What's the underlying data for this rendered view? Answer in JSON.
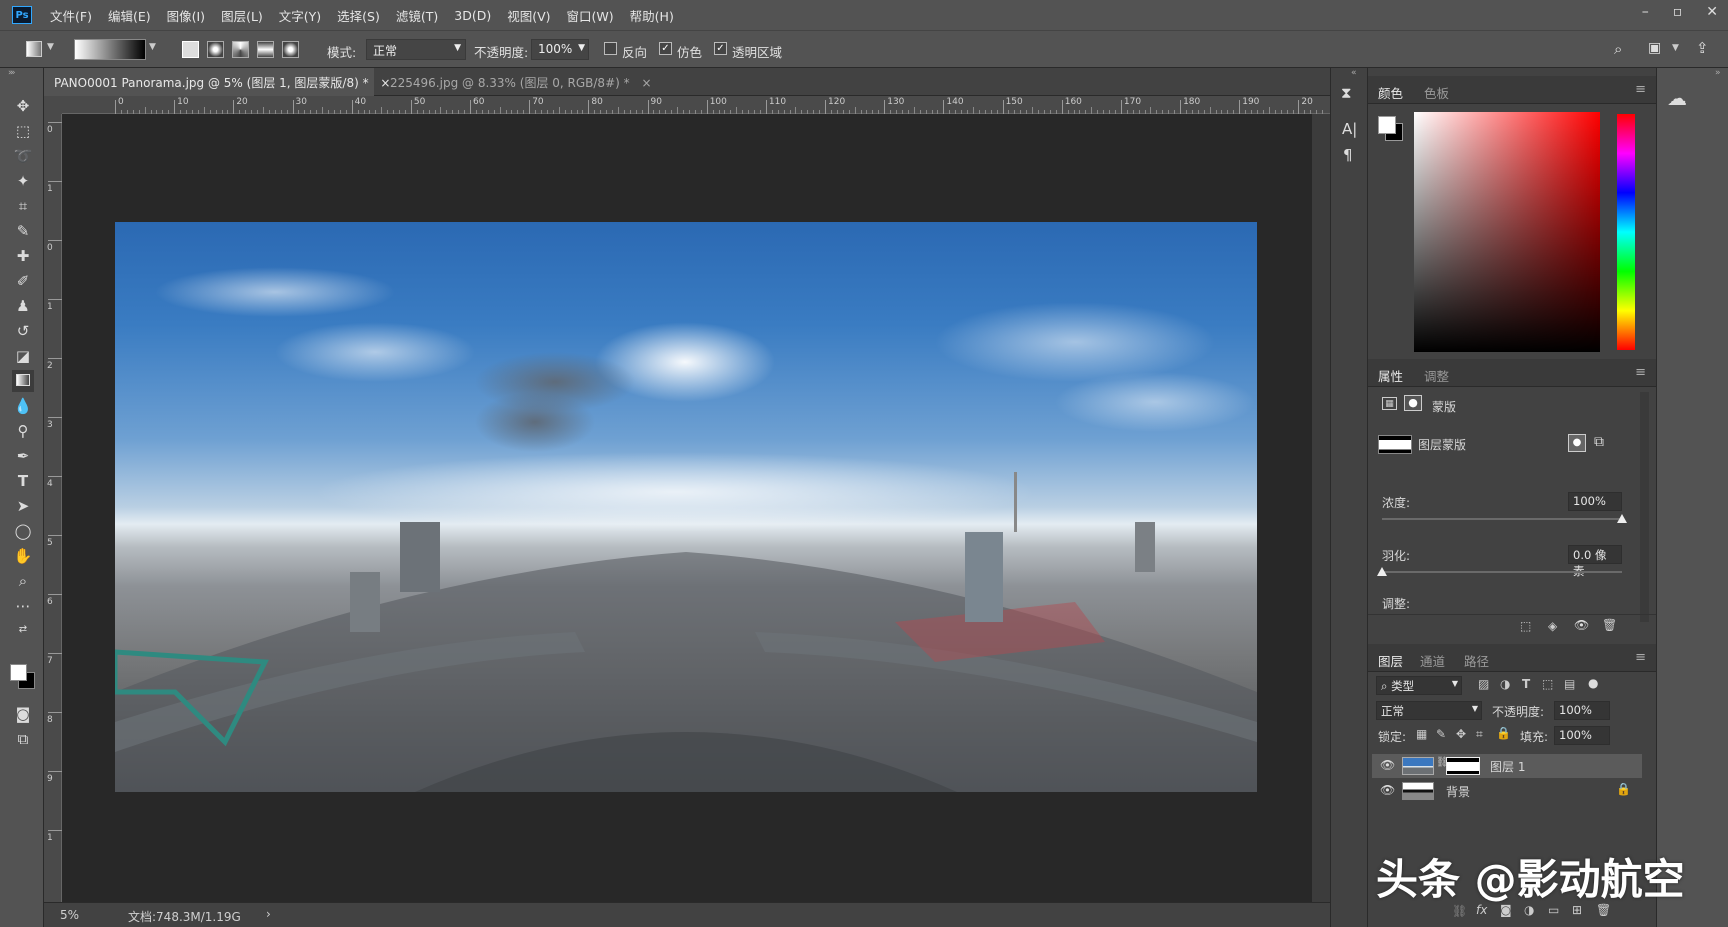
{
  "app": {
    "logo": "Ps",
    "menu": [
      "文件(F)",
      "编辑(E)",
      "图像(I)",
      "图层(L)",
      "文字(Y)",
      "选择(S)",
      "滤镜(T)",
      "3D(D)",
      "视图(V)",
      "窗口(W)",
      "帮助(H)"
    ],
    "window_controls": [
      "minimize-icon",
      "maximize-icon",
      "close-icon"
    ]
  },
  "options": {
    "mode_label": "模式:",
    "mode_value": "正常",
    "opacity_label": "不透明度:",
    "opacity_value": "100%",
    "reverse_label": "反向",
    "reverse_checked": false,
    "dither_label": "仿色",
    "dither_checked": true,
    "transparency_label": "透明区域",
    "transparency_checked": true
  },
  "documents": {
    "tabs": [
      {
        "title": "PANO0001 Panorama.jpg @ 5% (图层 1, 图层蒙版/8) *",
        "active": true
      },
      {
        "title": "225496.jpg @ 8.33% (图层 0, RGB/8#) *",
        "active": false
      }
    ],
    "close_glyph": "×"
  },
  "rulers": {
    "top_ticks": [
      "0",
      "10",
      "20",
      "30",
      "40",
      "50",
      "60",
      "70",
      "80",
      "90",
      "100",
      "110",
      "120",
      "130",
      "140",
      "150",
      "160",
      "170",
      "180",
      "190",
      "20"
    ],
    "left_ticks": [
      "0",
      "1",
      "0",
      "1",
      "2",
      "3",
      "4",
      "5",
      "6",
      "7",
      "8",
      "9",
      "1"
    ]
  },
  "status": {
    "zoom": "5%",
    "doc_info": "文档:748.3M/1.19G",
    "arrow": "›"
  },
  "color_panel": {
    "tabs": [
      "颜色",
      "色板"
    ],
    "hue_spectrum": [
      "#ff0000",
      "#ff00ff",
      "#0000ff",
      "#00ffff",
      "#00ff00",
      "#ffff00",
      "#ff0000"
    ],
    "base_color": "#ff0000"
  },
  "properties_panel": {
    "tabs": [
      "属性",
      "调整"
    ],
    "section_title": "蒙版",
    "mask_label": "图层蒙版",
    "density_label": "浓度:",
    "density_value": "100%",
    "density_level": 1.0,
    "feather_label": "羽化:",
    "feather_value": "0.0 像素",
    "feather_level": 0.0,
    "adjust_label": "调整:"
  },
  "layers_panel": {
    "tabs": [
      "图层",
      "通道",
      "路径"
    ],
    "filter_kind": "类型",
    "blend_mode": "正常",
    "opacity_label": "不透明度:",
    "opacity_value": "100%",
    "lock_label": "锁定:",
    "fill_label": "填充:",
    "fill_value": "100%",
    "layers": [
      {
        "name": "图层 1",
        "selected": true,
        "has_mask": true,
        "locked": false
      },
      {
        "name": "背景",
        "selected": false,
        "has_mask": false,
        "locked": true
      }
    ],
    "footer_icons": [
      "link-icon",
      "fx-icon",
      "mask-icon",
      "adjustment-icon",
      "folder-icon",
      "new-layer-icon",
      "trash-icon"
    ]
  },
  "watermark": "头条 @影动航空"
}
